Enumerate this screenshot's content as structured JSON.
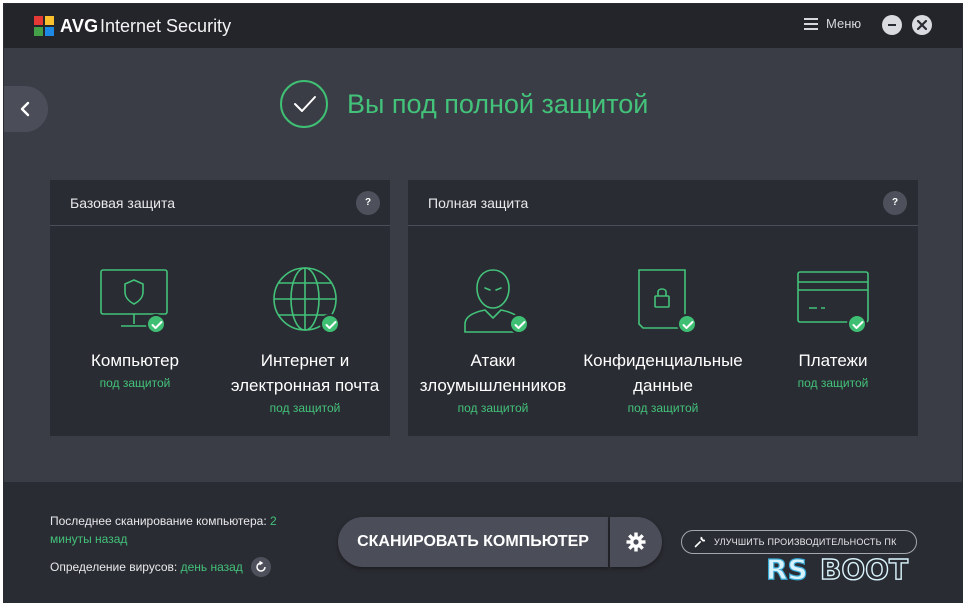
{
  "titlebar": {
    "brand": "AVG",
    "app_title": "Internet Security",
    "menu_label": "Меню"
  },
  "status": {
    "text": "Вы под полной защитой"
  },
  "panels": {
    "basic": {
      "title": "Базовая защита",
      "help": "?",
      "tiles": [
        {
          "name": "Компьютер",
          "status": "под защитой",
          "icon": "monitor-shield-icon"
        },
        {
          "name": "Интернет и электронная почта",
          "status": "под защитой",
          "icon": "globe-icon"
        }
      ]
    },
    "full": {
      "title": "Полная защита",
      "help": "?",
      "tiles": [
        {
          "name": "Атаки злоумышленников",
          "status": "под защитой",
          "icon": "hacker-icon"
        },
        {
          "name": "Конфиденциальные данные",
          "status": "под защитой",
          "icon": "locked-document-icon"
        },
        {
          "name": "Платежи",
          "status": "под защитой",
          "icon": "credit-card-icon"
        }
      ]
    }
  },
  "bottom": {
    "last_scan_label": "Последнее сканирование компьютера:",
    "last_scan_value": "2 минуты назад",
    "definitions_label": "Определение вирусов:",
    "definitions_value": "день назад",
    "scan_button": "СКАНИРОВАТЬ КОМПЬЮТЕР",
    "improve_button": "УЛУЧШИТЬ ПРОИЗВОДИТЕЛЬНОСТЬ ПК"
  },
  "watermark": {
    "part1": "RS",
    "part2": "BOOT"
  },
  "colors": {
    "accent_green": "#43c27a",
    "background": "#3a3d46",
    "panel": "#2a2c33",
    "titlebar": "#23252b"
  }
}
